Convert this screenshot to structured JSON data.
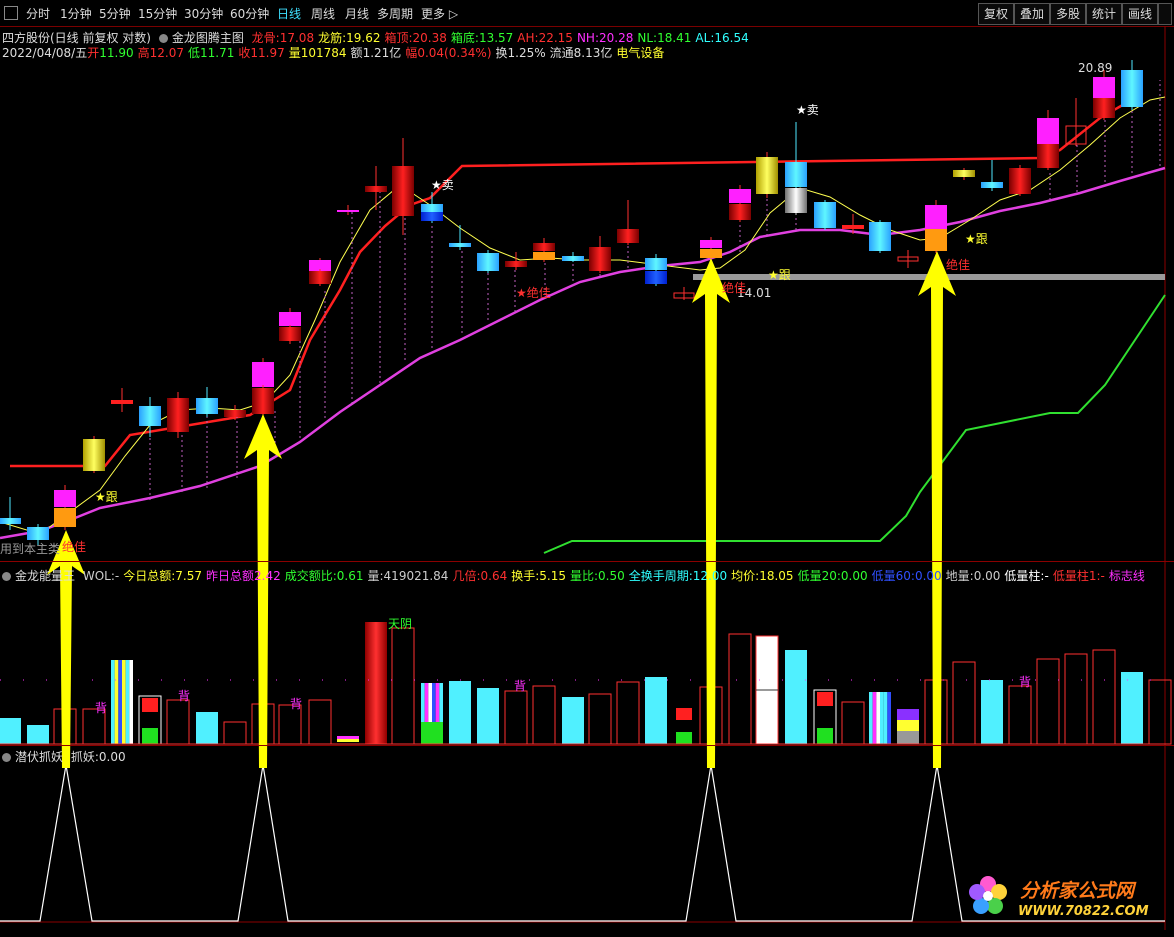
{
  "toolbar": {
    "tabs": [
      "分时",
      "1分钟",
      "5分钟",
      "15分钟",
      "30分钟",
      "60分钟",
      "日线",
      "周线",
      "月线",
      "多周期",
      "更多 ▷"
    ],
    "active": "日线",
    "right": [
      "复权",
      "叠加",
      "多股",
      "统计",
      "画线"
    ]
  },
  "main": {
    "title": "四方股份(日线 前复权 对数)",
    "indicator": "金龙图腾主图",
    "params": [
      {
        "label": "龙骨:",
        "value": "17.08",
        "color": "#ff3030"
      },
      {
        "label": "龙筋:",
        "value": "19.62",
        "color": "#ffff30"
      },
      {
        "label": "箱顶:",
        "value": "20.38",
        "color": "#ff3030"
      },
      {
        "label": "箱底:",
        "value": "13.57",
        "color": "#30ff30"
      },
      {
        "label": "AH:",
        "value": "22.15",
        "color": "#ff3030"
      },
      {
        "label": "NH:",
        "value": "20.28",
        "color": "#ff30ff"
      },
      {
        "label": "NL:",
        "value": "18.41",
        "color": "#30ff30"
      },
      {
        "label": "AL:",
        "value": "16.54",
        "color": "#30ffff"
      }
    ],
    "quote": {
      "date": "2022/04/08/五",
      "open_label": "开",
      "open": "11.90",
      "high_label": "高",
      "high": "12.07",
      "low_label": "低",
      "low": "11.71",
      "close_label": "收",
      "close": "11.97",
      "vol_label": "量",
      "vol": "101784",
      "amt_label": "额",
      "amt": "1.21亿",
      "chg_label": "幅",
      "chg": "0.04(0.34%)",
      "turn_label": "换",
      "turn": "1.25%",
      "float_label": "流通",
      "float": "8.13亿",
      "sector": "电气设备"
    },
    "annotations": {
      "sell1": "★卖",
      "sell2": "★卖",
      "follow1": "★跟",
      "follow2": "★跟",
      "follow3": "★跟",
      "best1": "绝佳",
      "best2": "★绝佳",
      "best3": "绝佳",
      "best4": "绝佳",
      "price_high": "20.89",
      "price_low": "14.01",
      "bottom_text": "用到本主类"
    }
  },
  "volume_panel": {
    "title": "金龙能量王",
    "items": [
      {
        "label": "WOL:",
        "value": "-",
        "color": "#cccccc"
      },
      {
        "label": "今日总额:",
        "value": "7.57",
        "color": "#ffff30"
      },
      {
        "label": "昨日总额",
        "value": "2.42",
        "color": "#ff30ff"
      },
      {
        "label": "成交额比:",
        "value": "0.61",
        "color": "#30ff30"
      },
      {
        "label": "量:",
        "value": "419021.84",
        "color": "#cccccc"
      },
      {
        "label": "几倍:",
        "value": "0.64",
        "color": "#ff3030"
      },
      {
        "label": "换手:",
        "value": "5.15",
        "color": "#ffff30"
      },
      {
        "label": "量比:",
        "value": "0.50",
        "color": "#30ff30"
      },
      {
        "label": "全换手周期:",
        "value": "12.00",
        "color": "#30ffff"
      },
      {
        "label": "均价:",
        "value": "18.05",
        "color": "#ffff30"
      },
      {
        "label": "低量20:",
        "value": "0.00",
        "color": "#30ff30"
      },
      {
        "label": "低量60:",
        "value": "0.00",
        "color": "#3050ff"
      },
      {
        "label": "地量:",
        "value": "0.00",
        "color": "#cccccc"
      },
      {
        "label": "低量柱:",
        "value": "-",
        "color": "#ffffff"
      },
      {
        "label": "低量柱1:",
        "value": "-",
        "color": "#ff3030"
      },
      {
        "label": "标志线",
        "value": "",
        "color": "#ff30ff"
      }
    ],
    "tianyin": "天阴",
    "bei": "背"
  },
  "bottom_panel": {
    "title": "潜伏抓妖",
    "label": "抓妖:",
    "value": "0.00"
  },
  "watermark": {
    "name": "分析家公式网",
    "url": "WWW.70822.COM"
  },
  "colors": {
    "up": "#ff2a2a",
    "down": "#4fe8ff",
    "magenta": "#ff2aff",
    "yellow": "#ffff30",
    "green": "#30e030",
    "bg": "#000000"
  }
}
